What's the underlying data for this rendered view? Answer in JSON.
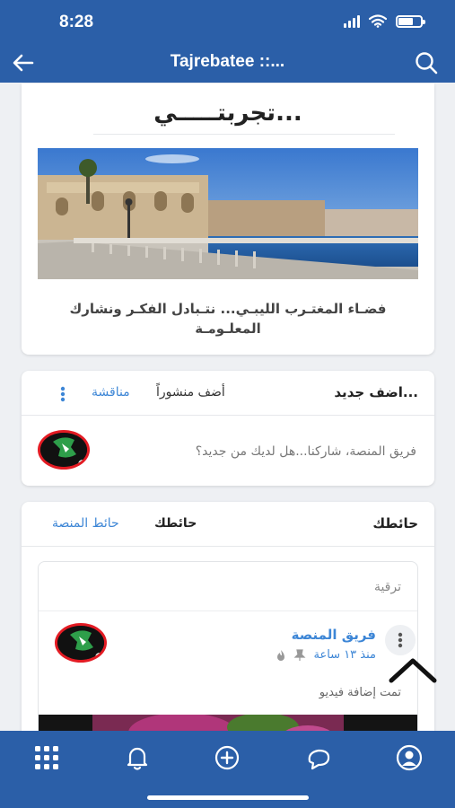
{
  "status": {
    "time": "8:28"
  },
  "header": {
    "title": "Tajrebatee ::..."
  },
  "intro": {
    "heading": "تجربتـــــي...",
    "description": "فضـاء المغتـرب الليبـي... نتـبادل الفكـر ونشارك المعلـومـة"
  },
  "composer": {
    "add_new": "اضف جديد...",
    "add_post": "أضف منشوراً",
    "discussion": "مناقشة",
    "prompt": "فريق المنصة، شاركنا...هل لديك من جديد؟"
  },
  "wall": {
    "title": "حائطك",
    "tab_my": "حائطك",
    "tab_platform": "حائط المنصة",
    "post": {
      "category": "ترقية",
      "author": "فريق المنصة",
      "time": "منذ ١٣ ساعة",
      "text": "تمت إضافة فيديو"
    }
  },
  "colors": {
    "brand": "#2b5fa8",
    "link": "#3d86d6",
    "avatar_ring": "#e31b23",
    "online": "#4cd137"
  },
  "icons": [
    "back-arrow-icon",
    "search-icon",
    "kebab-icon",
    "pin-icon",
    "fire-icon",
    "chevron-up-icon",
    "grid-icon",
    "bell-icon",
    "plus-circle-icon",
    "chat-icon",
    "profile-icon"
  ]
}
